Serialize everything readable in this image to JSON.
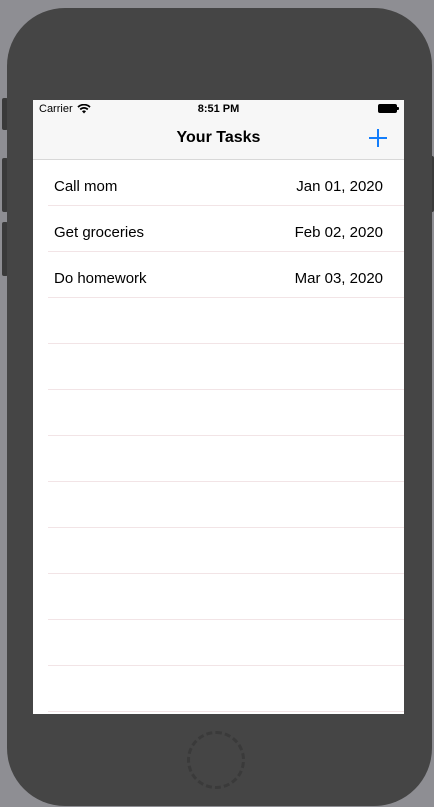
{
  "status_bar": {
    "carrier": "Carrier",
    "time": "8:51 PM",
    "wifi_icon": "wifi-icon",
    "battery_icon": "battery-icon"
  },
  "nav": {
    "title": "Your Tasks",
    "add_icon": "plus-icon"
  },
  "tasks": [
    {
      "title": "Call mom",
      "date": "Jan 01, 2020"
    },
    {
      "title": "Get groceries",
      "date": "Feb 02, 2020"
    },
    {
      "title": "Do homework",
      "date": "Mar 03, 2020"
    }
  ],
  "colors": {
    "accent": "#147efb",
    "separator": "#f2e4e6",
    "device": "#454545"
  }
}
